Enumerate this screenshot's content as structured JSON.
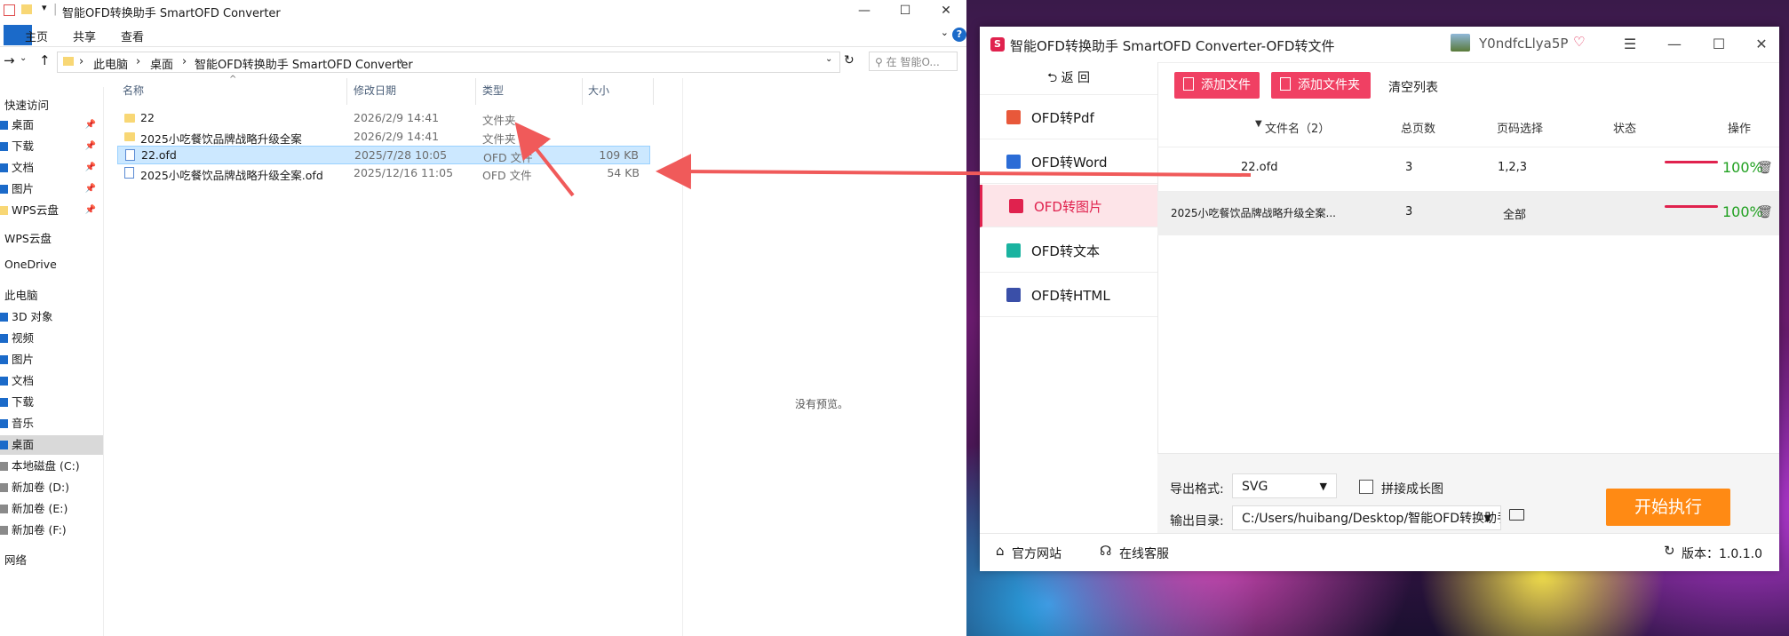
{
  "explorer": {
    "title": "智能OFD转换助手 SmartOFD Converter",
    "ribbon_tabs": [
      "主页",
      "共享",
      "查看"
    ],
    "breadcrumb": [
      "此电脑",
      "桌面",
      "智能OFD转换助手 SmartOFD Converter"
    ],
    "search_placeholder": "在 智能O...",
    "nav": {
      "quick_access": "快速访问",
      "quick_items": [
        {
          "label": "桌面"
        },
        {
          "label": "下载"
        },
        {
          "label": "文档"
        },
        {
          "label": "图片"
        },
        {
          "label": "WPS云盘"
        }
      ],
      "wps": "WPS云盘",
      "onedrive": "OneDrive",
      "this_pc": "此电脑",
      "pc_items": [
        {
          "label": "3D 对象"
        },
        {
          "label": "视频"
        },
        {
          "label": "图片"
        },
        {
          "label": "文档"
        },
        {
          "label": "下载"
        },
        {
          "label": "音乐"
        },
        {
          "label": "桌面"
        },
        {
          "label": "本地磁盘 (C:)"
        },
        {
          "label": "新加卷 (D:)"
        },
        {
          "label": "新加卷 (E:)"
        },
        {
          "label": "新加卷 (F:)"
        }
      ],
      "network": "网络"
    },
    "columns": {
      "name": "名称",
      "date": "修改日期",
      "type": "类型",
      "size": "大小"
    },
    "files": [
      {
        "name": "22",
        "date": "2026/2/9 14:41",
        "type": "文件夹",
        "size": ""
      },
      {
        "name": "2025小吃餐饮品牌战略升级全案",
        "date": "2026/2/9 14:41",
        "type": "文件夹",
        "size": ""
      },
      {
        "name": "22.ofd",
        "date": "2025/7/28 10:05",
        "type": "OFD 文件",
        "size": "109 KB"
      },
      {
        "name": "2025小吃餐饮品牌战略升级全案.ofd",
        "date": "2025/12/16 11:05",
        "type": "OFD 文件",
        "size": "54 KB"
      }
    ],
    "preview": "没有预览。"
  },
  "app": {
    "title": "智能OFD转换助手 SmartOFD Converter-OFD转文件",
    "user": "Y0ndfcLlya5P",
    "back": "返 回",
    "sidebar": [
      {
        "label": "OFD转Pdf",
        "color": "#e8583a"
      },
      {
        "label": "OFD转Word",
        "color": "#2b6cd6"
      },
      {
        "label": "OFD转图片",
        "color": "#e0224e"
      },
      {
        "label": "OFD转文本",
        "color": "#1ab3a0"
      },
      {
        "label": "OFD转HTML",
        "color": "#3a4fa8"
      }
    ],
    "toolbar": {
      "add_file": "添加文件",
      "add_folder": "添加文件夹",
      "clear": "清空列表"
    },
    "table": {
      "headers": {
        "name": "文件名（2）",
        "pages": "总页数",
        "page_select": "页码选择",
        "status": "状态",
        "op": "操作"
      },
      "rows": [
        {
          "name": "22.ofd",
          "pages": "3",
          "page_select": "1,2,3",
          "status": "100%",
          "progress": 100
        },
        {
          "name": "2025小吃餐饮品牌战略升级全案...",
          "pages": "3",
          "page_select": "全部",
          "status": "100%",
          "progress": 100
        }
      ]
    },
    "bottom": {
      "format_label": "导出格式:",
      "format_value": "SVG",
      "merge_label": "拼接成长图",
      "output_label": "输出目录:",
      "output_value": "C:/Users/huibang/Desktop/智能OFD转换助手 Smart",
      "start": "开始执行"
    },
    "footer": {
      "website": "官方网站",
      "service": "在线客服",
      "version": "版本：1.0.1.0"
    }
  },
  "colors": {
    "accent": "#e0224e",
    "start": "#ff8a14",
    "selection": "#cce8ff"
  }
}
